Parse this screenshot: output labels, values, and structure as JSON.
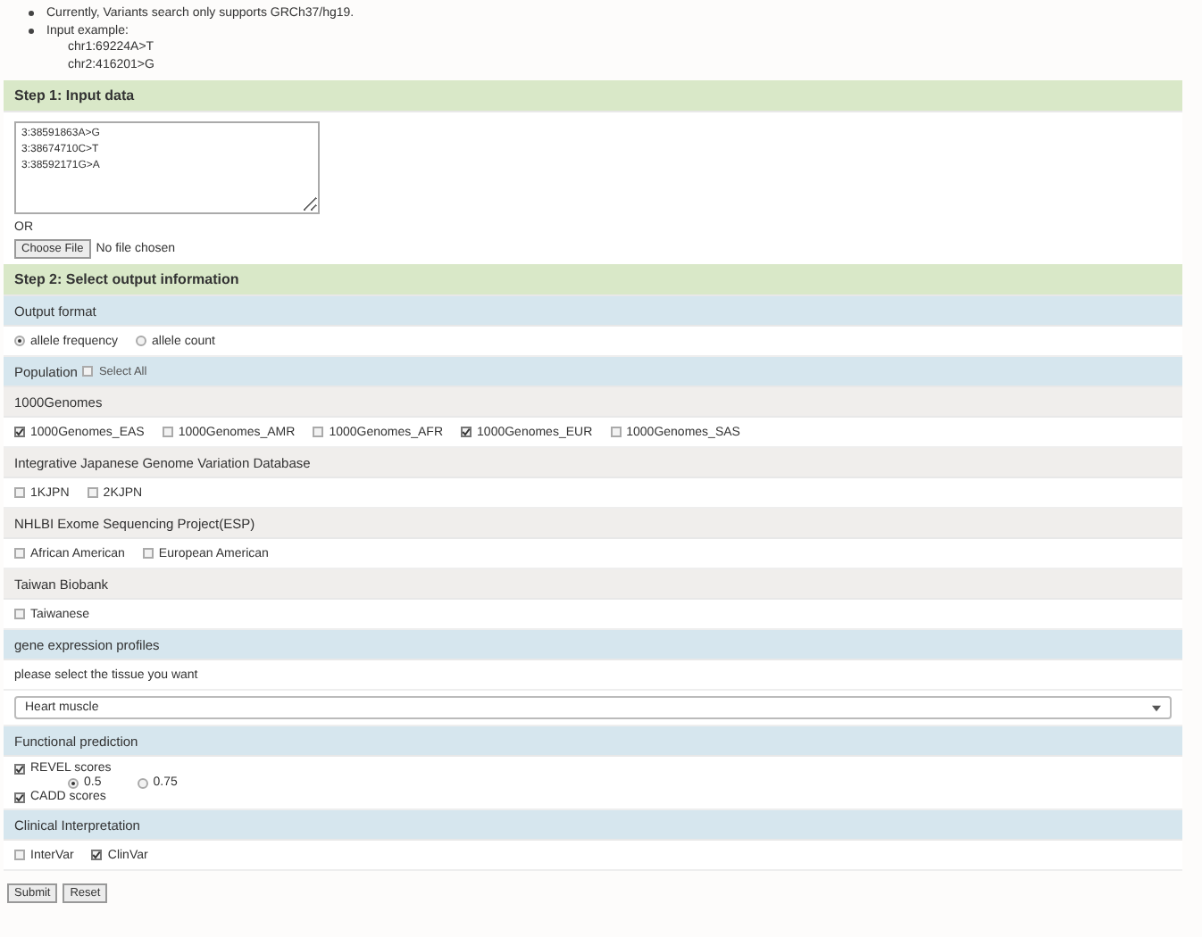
{
  "notes": [
    "Currently, Variants search only supports GRCh37/hg19.",
    "Input example:"
  ],
  "examples": [
    "chr1:69224A>T",
    "chr2:416201>G"
  ],
  "step1": {
    "title": "Step 1: Input data",
    "textarea": "3:38591863A>G\n3:38674710C>T\n3:38592171G>A",
    "or_label": "OR",
    "file_button": "Choose File",
    "file_status": "No file chosen"
  },
  "step2": {
    "title": "Step 2: Select output information"
  },
  "sections": [
    {
      "kind": "section",
      "title": "Output format",
      "options": [
        {
          "kind": "radio",
          "label": "allele frequency",
          "selected": true
        },
        {
          "kind": "radio",
          "label": "allele count",
          "selected": false
        }
      ]
    },
    {
      "kind": "section",
      "title": "Population",
      "select_all": {
        "label": "Select All",
        "checked": false
      }
    },
    {
      "kind": "group",
      "title": "1000Genomes",
      "options": [
        {
          "kind": "checkbox",
          "label": "1000Genomes_EAS",
          "checked": true
        },
        {
          "kind": "checkbox",
          "label": "1000Genomes_AMR",
          "checked": false
        },
        {
          "kind": "checkbox",
          "label": "1000Genomes_AFR",
          "checked": false
        },
        {
          "kind": "checkbox",
          "label": "1000Genomes_EUR",
          "checked": true
        },
        {
          "kind": "checkbox",
          "label": "1000Genomes_SAS",
          "checked": false
        }
      ]
    },
    {
      "kind": "group",
      "title": "Integrative Japanese Genome Variation Database",
      "options": [
        {
          "kind": "checkbox",
          "label": "1KJPN",
          "checked": false
        },
        {
          "kind": "checkbox",
          "label": "2KJPN",
          "checked": false
        }
      ]
    },
    {
      "kind": "group",
      "title": "NHLBI Exome Sequencing Project(ESP)",
      "options": [
        {
          "kind": "checkbox",
          "label": "African American",
          "checked": false
        },
        {
          "kind": "checkbox",
          "label": "European American",
          "checked": false
        }
      ]
    },
    {
      "kind": "group",
      "title": "Taiwan Biobank",
      "options": [
        {
          "kind": "checkbox",
          "label": "Taiwanese",
          "checked": false
        }
      ]
    },
    {
      "kind": "section",
      "title": "gene expression profiles",
      "prompt": "please select the tissue you want",
      "dropdown": "Heart muscle"
    },
    {
      "kind": "section",
      "title": "Functional prediction",
      "options": [
        {
          "kind": "checkbox",
          "label": "REVEL scores",
          "checked": true,
          "children": [
            {
              "kind": "radio",
              "label": "0.5",
              "selected": true
            },
            {
              "kind": "radio",
              "label": "0.75",
              "selected": false
            }
          ]
        },
        {
          "kind": "checkbox",
          "label": "CADD scores",
          "checked": true
        }
      ]
    },
    {
      "kind": "section",
      "title": "Clinical Interpretation",
      "options": [
        {
          "kind": "checkbox",
          "label": "InterVar",
          "checked": false
        },
        {
          "kind": "checkbox",
          "label": "ClinVar",
          "checked": true
        }
      ]
    }
  ],
  "buttons": [
    "Submit",
    "Reset"
  ]
}
